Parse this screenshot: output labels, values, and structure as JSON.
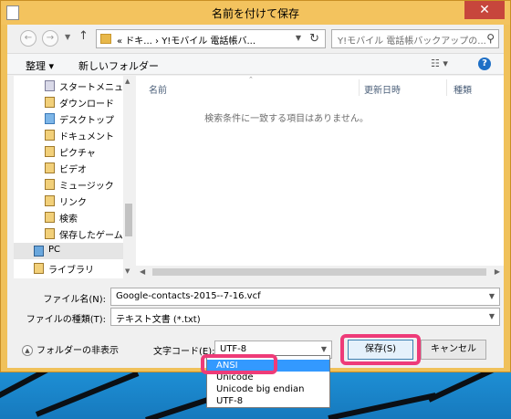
{
  "window": {
    "title": "名前を付けて保存",
    "close_glyph": "✕"
  },
  "address": {
    "back_glyph": "←",
    "forward_glyph": "→",
    "up_glyph": "↑",
    "breadcrumb": "«  ドキ...  ›  Y!モバイル 電話帳バ...",
    "refresh_glyph": "↻",
    "search_placeholder": "Y!モバイル 電話帳バックアップの...",
    "search_glyph": "⚲"
  },
  "toolbar": {
    "organize": "整理 ▾",
    "new_folder": "新しいフォルダー",
    "view": "☷ ▾",
    "help": "?"
  },
  "nav": {
    "items": [
      {
        "label": "スタートメニュー",
        "icon": "start-menu-icon"
      },
      {
        "label": "ダウンロード",
        "icon": "downloads-icon"
      },
      {
        "label": "デスクトップ",
        "icon": "desktop-icon"
      },
      {
        "label": "ドキュメント",
        "icon": "documents-icon"
      },
      {
        "label": "ピクチャ",
        "icon": "pictures-icon"
      },
      {
        "label": "ビデオ",
        "icon": "videos-icon"
      },
      {
        "label": "ミュージック",
        "icon": "music-icon"
      },
      {
        "label": "リンク",
        "icon": "links-icon"
      },
      {
        "label": "検索",
        "icon": "searches-icon"
      },
      {
        "label": "保存したゲーム",
        "icon": "saved-games-icon"
      },
      {
        "label": "PC",
        "icon": "pc-icon"
      },
      {
        "label": "ライブラリ",
        "icon": "libraries-icon"
      }
    ]
  },
  "filelist": {
    "columns": [
      "名前",
      "更新日時",
      "種類"
    ],
    "empty_message": "検索条件に一致する項目はありません。"
  },
  "form": {
    "filename_label": "ファイル名(N):",
    "filename_value": "Google-contacts-2015--7-16.vcf",
    "filetype_label": "ファイルの種類(T):",
    "filetype_value": "テキスト文書 (*.txt)",
    "encoding_label": "文字コード(E):",
    "encoding_value": "UTF-8",
    "hide_folders": "フォルダーの非表示",
    "save_button": "保存(S)",
    "cancel_button": "キャンセル"
  },
  "encoding_options": [
    "ANSI",
    "Unicode",
    "Unicode big endian",
    "UTF-8"
  ],
  "colors": {
    "highlight": "#ee3b78",
    "window_frame": "#f3c35e",
    "selection": "#3399ff"
  }
}
